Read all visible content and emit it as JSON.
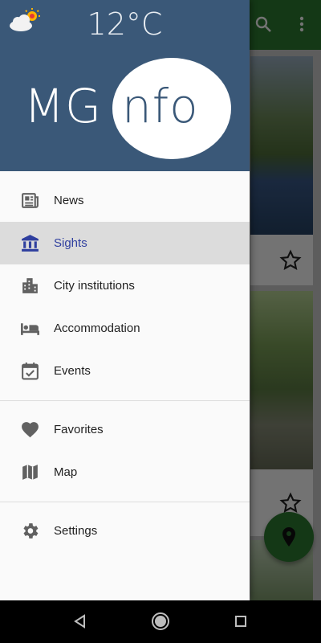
{
  "header": {
    "weather_icon": "partly-cloudy-icon",
    "temperature": "12°C",
    "logo_part1": "MG",
    "logo_part2": "nfo"
  },
  "menu": {
    "primary": [
      {
        "label": "News",
        "icon": "newspaper-icon"
      },
      {
        "label": "Sights",
        "icon": "bank-icon",
        "selected": true
      },
      {
        "label": "City institutions",
        "icon": "city-icon"
      },
      {
        "label": "Accommodation",
        "icon": "hotel-bed-icon"
      },
      {
        "label": "Events",
        "icon": "calendar-check-icon"
      }
    ],
    "secondary": [
      {
        "label": "Favorites",
        "icon": "heart-icon"
      },
      {
        "label": "Map",
        "icon": "map-icon"
      }
    ],
    "tertiary": [
      {
        "label": "Settings",
        "icon": "gear-icon"
      }
    ]
  },
  "colors": {
    "header_bg": "#3a5878",
    "selected_text": "#2f3f9f",
    "selected_bg": "#dcdcdc",
    "toolbar": "#2e7d32"
  },
  "navbar": {
    "buttons": [
      "back-icon",
      "home-icon",
      "recents-icon"
    ]
  }
}
